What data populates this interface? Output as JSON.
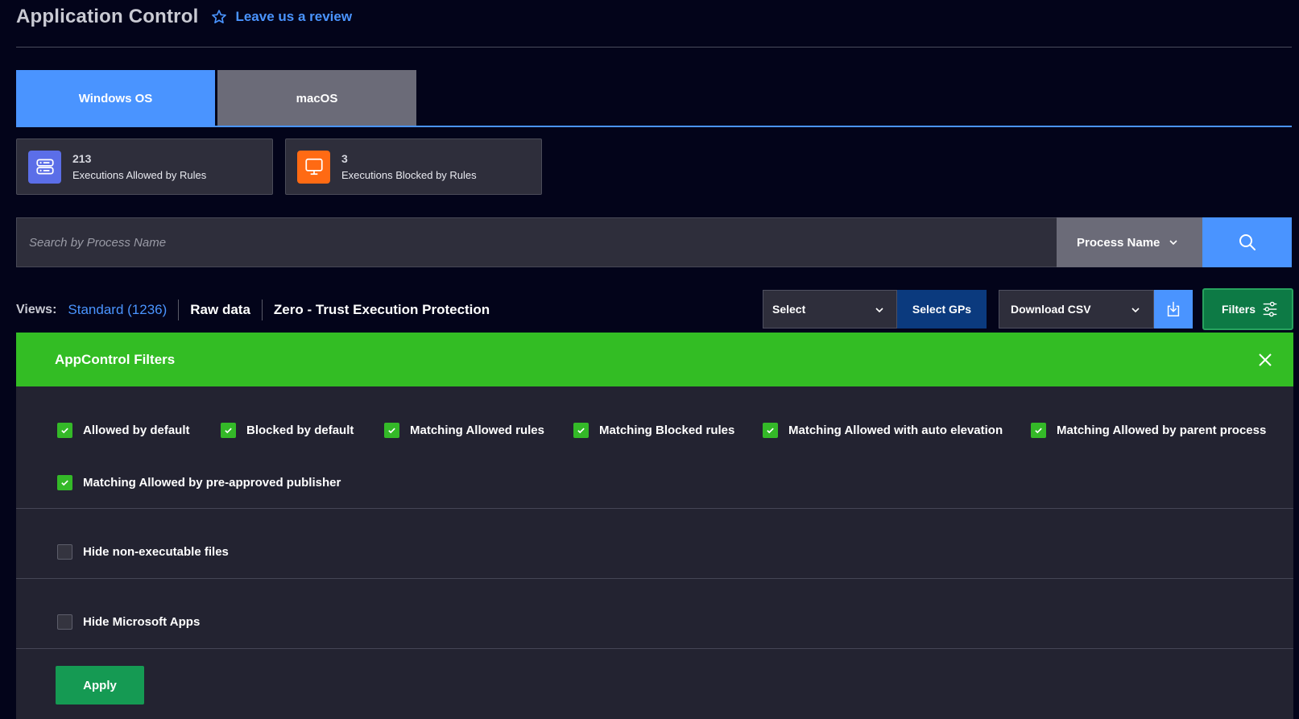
{
  "header": {
    "title": "Application Control",
    "review_link": "Leave us a review"
  },
  "os_tabs": [
    {
      "label": "Windows OS",
      "active": true
    },
    {
      "label": "macOS",
      "active": false
    }
  ],
  "stats": [
    {
      "value": "213",
      "label": "Executions Allowed by Rules",
      "icon": "server-icon",
      "color": "#5b6ee8"
    },
    {
      "value": "3",
      "label": "Executions Blocked by Rules",
      "icon": "monitor-icon",
      "color": "#ff6a13"
    }
  ],
  "search": {
    "placeholder": "Search by Process Name",
    "value": "",
    "field_select": "Process Name"
  },
  "views": {
    "label": "Views:",
    "items": [
      "Standard (1236)",
      "Raw data",
      "Zero - Trust Execution Protection"
    ]
  },
  "toolbar": {
    "select_label": "Select",
    "select_gps_label": "Select GPs",
    "download_label": "Download CSV",
    "filters_label": "Filters"
  },
  "filters_panel": {
    "title": "AppControl Filters",
    "checkboxes": [
      {
        "label": "Allowed by default",
        "checked": true
      },
      {
        "label": "Blocked by default",
        "checked": true
      },
      {
        "label": "Matching Allowed rules",
        "checked": true
      },
      {
        "label": "Matching Blocked rules",
        "checked": true
      },
      {
        "label": "Matching Allowed with auto elevation",
        "checked": true
      },
      {
        "label": "Matching Allowed by parent process",
        "checked": true
      },
      {
        "label": "Matching Allowed by pre-approved publisher",
        "checked": true
      }
    ],
    "hide_nonexec": {
      "label": "Hide non-executable files",
      "checked": false
    },
    "hide_ms": {
      "label": "Hide Microsoft Apps",
      "checked": false
    },
    "apply_label": "Apply"
  },
  "colors": {
    "background": "#03041a",
    "accent_blue": "#4a94ff",
    "green_header": "#33bd24",
    "apply_green": "#159a53"
  }
}
